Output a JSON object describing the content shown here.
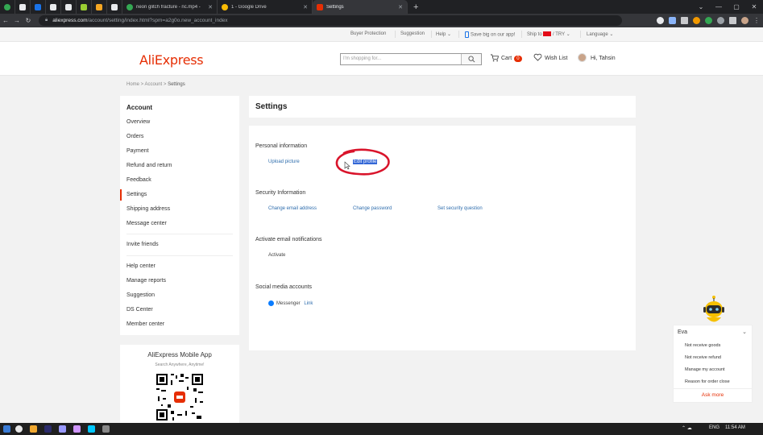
{
  "browser": {
    "tabs": [
      {
        "title": "neon glitch fracture - nc.mp4 -",
        "icon_color": "#34a853"
      },
      {
        "title": "1 - Google Drive",
        "icon_color": "#fbbc04"
      },
      {
        "title": "Settings",
        "icon_color": "#e62e04"
      }
    ],
    "new_tab": "+",
    "url_domain": "aliexpress.com",
    "url_path": "/account/setting/index.html?spm=a2g0o.new_account_index"
  },
  "topstrip": {
    "buyer_protection": "Buyer Protection",
    "suggestion": "Suggestion",
    "help": "Help",
    "app": "Save big on our app!",
    "ship_to": "Ship to",
    "currency": "TRY",
    "language": "Language"
  },
  "header": {
    "logo": "AliExpress",
    "search_placeholder": "I'm shopping for...",
    "cart": "Cart",
    "cart_count": "0",
    "wishlist": "Wish List",
    "greeting": "Hi, Tahsin"
  },
  "breadcrumb": {
    "home": "Home",
    "account": "Account",
    "current": "Settings"
  },
  "sidebar": {
    "title": "Account",
    "group1": [
      "Overview",
      "Orders",
      "Payment",
      "Refund and return",
      "Feedback",
      "Settings",
      "Shipping address",
      "Message center"
    ],
    "group2": [
      "Invite friends"
    ],
    "group3": [
      "Help center",
      "Manage reports",
      "Suggestion",
      "DS Center",
      "Member center"
    ]
  },
  "app_box": {
    "title": "AliExpress Mobile App",
    "subtitle": "Search Anywhere, Anytime!"
  },
  "main": {
    "title": "Settings",
    "personal": {
      "heading": "Personal information",
      "upload": "Upload picture",
      "edit": "Edit profile"
    },
    "security": {
      "heading": "Security Information",
      "email": "Change email address",
      "password": "Change password",
      "question": "Set security question"
    },
    "notifications": {
      "heading": "Activate email notifications",
      "activate": "Activate"
    },
    "social": {
      "heading": "Social media accounts",
      "messenger": "Messenger",
      "link": "Link"
    }
  },
  "chat": {
    "name": "Eva",
    "questions": [
      "Not receive goods",
      "Not receive refund",
      "Manage my account",
      "Reason for order close"
    ],
    "ask_more": "Ask more"
  },
  "taskbar": {
    "lang": "ENG",
    "time": "11:54 AM"
  },
  "colors": {
    "brand": "#e62e04",
    "link": "#2e6dad"
  }
}
